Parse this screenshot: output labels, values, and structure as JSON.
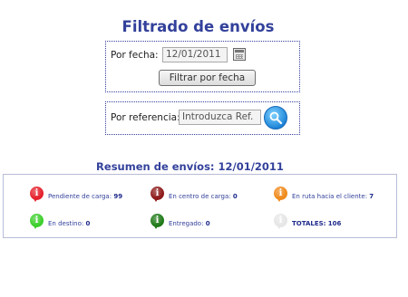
{
  "page": {
    "title": "Filtrado de envíos"
  },
  "date_filter": {
    "label": "Por fecha:",
    "value": "12/01/2011",
    "button_label": "Filtrar por fecha"
  },
  "ref_filter": {
    "label": "Por referencia:",
    "placeholder": "Introduzca Ref."
  },
  "summary": {
    "title": "Resumen de envíos: 12/01/2011",
    "items": [
      {
        "label": "Pendiente de carga:",
        "count": "99",
        "color": "#e5202c",
        "icon": "info-red-icon"
      },
      {
        "label": "En centro de carga:",
        "count": "0",
        "color": "#8e1a1a",
        "icon": "info-darkred-icon"
      },
      {
        "label": "En ruta hacia el cliente:",
        "count": "7",
        "color": "#f08a1c",
        "icon": "info-orange-icon"
      },
      {
        "label": "En destino:",
        "count": "0",
        "color": "#3ccf2b",
        "icon": "info-green-icon"
      },
      {
        "label": "Entregado:",
        "count": "0",
        "color": "#1f7a18",
        "icon": "info-darkgreen-icon"
      },
      {
        "label": "TOTALES:",
        "count": "106",
        "color": "#e6e6e6",
        "icon": "info-gray-icon"
      }
    ]
  }
}
